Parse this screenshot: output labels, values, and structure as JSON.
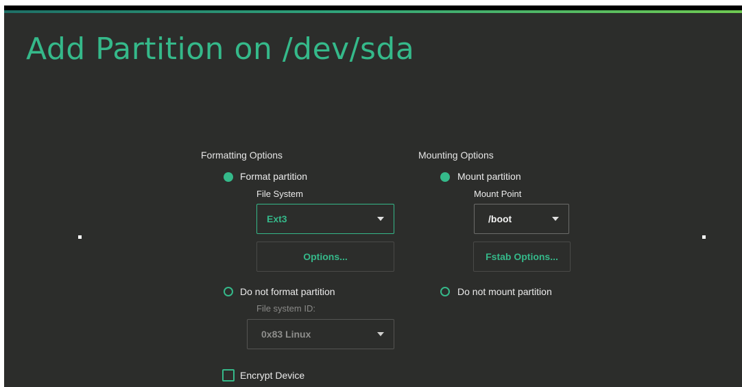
{
  "title": "Add Partition on /dev/sda",
  "formatting": {
    "heading": "Formatting Options",
    "format_partition": "Format partition",
    "file_system_label": "File System",
    "file_system_value": "Ext3",
    "options_button": "Options...",
    "do_not_format": "Do not format partition",
    "fs_id_label": "File system ID:",
    "fs_id_value": "0x83 Linux",
    "encrypt_device": "Encrypt Device"
  },
  "mounting": {
    "heading": "Mounting Options",
    "mount_partition": "Mount partition",
    "mount_point_label": "Mount Point",
    "mount_point_value": "/boot",
    "fstab_button": "Fstab Options...",
    "do_not_mount": "Do not mount partition"
  },
  "colors": {
    "accent": "#35b98a",
    "background": "#2c2d2b"
  }
}
